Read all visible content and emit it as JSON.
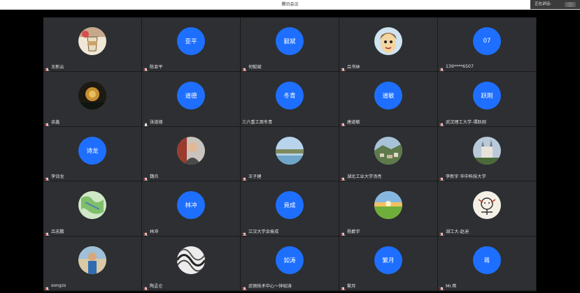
{
  "app": {
    "title": "腾讯会议",
    "speaking_label": "正在讲话:"
  },
  "participants": [
    {
      "name": "王新云",
      "avatar_text": "",
      "avatar": "photo-drink",
      "mic": "muted"
    },
    {
      "name": "陈亚平",
      "avatar_text": "亚平",
      "avatar": "text",
      "mic": "muted"
    },
    {
      "name": "何毅斌",
      "avatar_text": "毅斌",
      "avatar": "text",
      "mic": "muted"
    },
    {
      "name": "吕书林",
      "avatar_text": "",
      "avatar": "photo-cartoon",
      "mic": "muted"
    },
    {
      "name": "139****6507",
      "avatar_text": "07",
      "avatar": "text",
      "mic": "muted"
    },
    {
      "name": "余鑫",
      "avatar_text": "",
      "avatar": "photo-dark",
      "mic": "muted"
    },
    {
      "name": "张道德",
      "avatar_text": "道德",
      "avatar": "text",
      "mic": "on"
    },
    {
      "name": "三六重工周冬青",
      "avatar_text": "冬青",
      "avatar": "text",
      "mic": "none"
    },
    {
      "name": "唐道敏",
      "avatar_text": "道敏",
      "avatar": "text",
      "mic": "muted"
    },
    {
      "name": "武汉理工大学-谭跃刚",
      "avatar_text": "跃刚",
      "avatar": "text",
      "mic": "muted"
    },
    {
      "name": "李诗龙",
      "avatar_text": "诗龙",
      "avatar": "text",
      "mic": "muted"
    },
    {
      "name": "魏兵",
      "avatar_text": "",
      "avatar": "photo-person",
      "mic": "muted"
    },
    {
      "name": "王子建",
      "avatar_text": "",
      "avatar": "photo-lake",
      "mic": "muted"
    },
    {
      "name": "湖北工业大学汤亮",
      "avatar_text": "",
      "avatar": "photo-town",
      "mic": "muted"
    },
    {
      "name": "李新宇 华中科技大学",
      "avatar_text": "",
      "avatar": "photo-castle",
      "mic": "muted"
    },
    {
      "name": "吕志鹏",
      "avatar_text": "",
      "avatar": "photo-map",
      "mic": "muted"
    },
    {
      "name": "林冲",
      "avatar_text": "林冲",
      "avatar": "text",
      "mic": "muted"
    },
    {
      "name": "江汉大学余竟成",
      "avatar_text": "竟成",
      "avatar": "text",
      "mic": "muted"
    },
    {
      "name": "杨爵宇",
      "avatar_text": "",
      "avatar": "photo-field",
      "mic": "muted"
    },
    {
      "name": "湖工大-赵迪",
      "avatar_text": "",
      "avatar": "photo-doodle",
      "mic": "muted"
    },
    {
      "name": "songzs",
      "avatar_text": "",
      "avatar": "photo-man",
      "mic": "muted"
    },
    {
      "name": "陶孟仑",
      "avatar_text": "",
      "avatar": "photo-bw",
      "mic": "muted"
    },
    {
      "name": "武钢技术中心～钟如涛",
      "avatar_text": "如涛",
      "avatar": "text",
      "mic": "muted"
    },
    {
      "name": "繁月",
      "avatar_text": "繁月",
      "avatar": "text",
      "mic": "muted"
    },
    {
      "name": "Mr.蒋",
      "avatar_text": "蒋",
      "avatar": "text",
      "mic": "muted"
    }
  ],
  "colors": {
    "avatar_blue": "#1e6fff",
    "tile_bg": "#2d2f32",
    "mic_muted": "#ff4d4f"
  }
}
